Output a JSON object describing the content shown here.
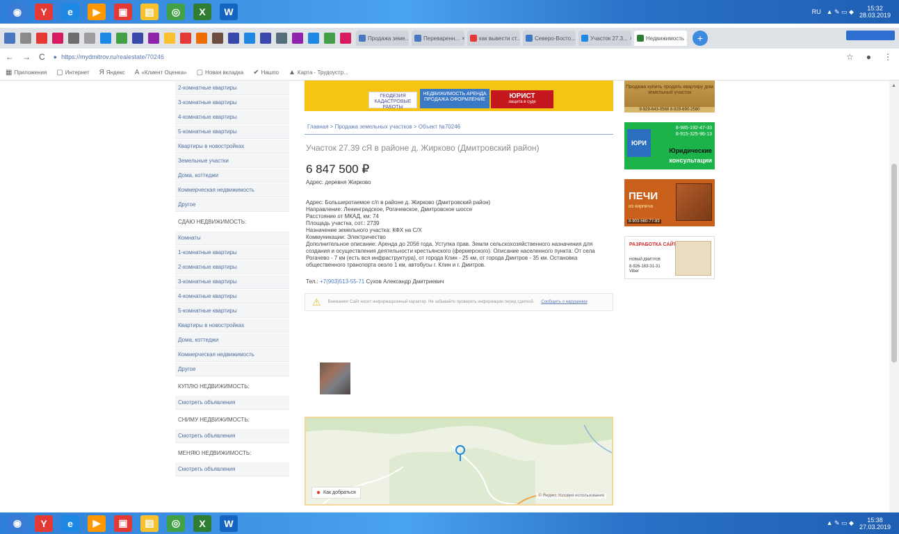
{
  "taskbar_top": {
    "icons": [
      {
        "name": "start-icon",
        "color": "#3a7bd5",
        "glyph": "◉"
      },
      {
        "name": "yandex-icon",
        "color": "#e53935",
        "glyph": "Y"
      },
      {
        "name": "ie-icon",
        "color": "#1e88e5",
        "glyph": "e"
      },
      {
        "name": "media-icon",
        "color": "#ff9800",
        "glyph": "▶"
      },
      {
        "name": "pdf-icon",
        "color": "#e53935",
        "glyph": "▣"
      },
      {
        "name": "explorer-icon",
        "color": "#fbc02d",
        "glyph": "▤"
      },
      {
        "name": "chrome-icon",
        "color": "#43a047",
        "glyph": "◎"
      },
      {
        "name": "excel-icon",
        "color": "#2e7d32",
        "glyph": "X"
      },
      {
        "name": "word-icon",
        "color": "#1565c0",
        "glyph": "W"
      }
    ],
    "tray_lang": "RU",
    "time": "15:32",
    "date": "28.03.2019"
  },
  "taskbar_bottom": {
    "time": "15:38",
    "date": "27.03.2019"
  },
  "tabs": [
    {
      "label": "Продажа земе...",
      "color": "#4a78c0"
    },
    {
      "label": "Переваренн...",
      "color": "#4a78c0"
    },
    {
      "label": "как вывести ст...",
      "color": "#e53935"
    },
    {
      "label": "Северо-Восто...",
      "color": "#3b79c7"
    },
    {
      "label": "Участок 27.3...",
      "color": "#1e88e5"
    },
    {
      "label": "Недвижимость",
      "color": "#2e7d32",
      "active": true
    }
  ],
  "toolbar": {
    "back": "←",
    "forward": "→",
    "reload": "C",
    "url_host": "https://mydmitrov.ru",
    "url_path": "/realestate/70246",
    "menu": "⋮"
  },
  "bookmarks": [
    {
      "icon": "apps-icon",
      "glyph": "▦",
      "label": "Приложения"
    },
    {
      "icon": "folder-icon",
      "glyph": "▢",
      "label": "Интернет"
    },
    {
      "icon": "yandex-bookmark-icon",
      "glyph": "Я",
      "label": "Яндекс"
    },
    {
      "icon": "a-icon",
      "glyph": "A",
      "label": "«Клиент Оценка»"
    },
    {
      "icon": "folder-icon",
      "glyph": "▢",
      "label": "Новая вкладка"
    },
    {
      "icon": "check-icon",
      "glyph": "✔",
      "label": "Нашпо"
    },
    {
      "icon": "maps-icon",
      "glyph": "▲",
      "label": "Карта - Трудоустр..."
    }
  ],
  "sidebar": {
    "group1": [
      "2-комнатные квартиры",
      "3-комнатные квартиры",
      "4-комнатные квартиры",
      "5-комнатные квартиры",
      "Квартиры в новостройках",
      "Земельные участки",
      "Дома, коттеджи",
      "Коммерческая недвижимость",
      "Другое"
    ],
    "rent_head": "Сдаю недвижимость:",
    "group2": [
      "Комнаты",
      "1-комнатные квартиры",
      "2-комнатные квартиры",
      "3-комнатные квартиры",
      "4-комнатные квартиры",
      "5-комнатные квартиры",
      "Квартиры в новостройках",
      "Дома, коттеджи",
      "Коммерческая недвижимость",
      "Другое"
    ],
    "buy_head": "Куплю недвижимость:",
    "buy_link": "Смотреть объявления",
    "hire_head": "Сниму недвижимость:",
    "hire_link": "Смотреть объявления",
    "swap_head": "Меняю недвижимость:",
    "swap_link": "Смотреть объявления"
  },
  "banner": {
    "b1": "ГЕОДЕЗИЯ КАДАСТРОВЫЕ РАБОТЫ",
    "b2": "НЕДВИЖИМОСТЬ АРЕНДА ПРОДАЖА ОФОРМЛЕНИЕ",
    "b3": "ЮРИСТ",
    "b3_sub": "защита в суде"
  },
  "listing": {
    "breadcrumbs": "Главная > Продажа земельных участков > Объект №70246",
    "title": "Участок 27.39 сЯ в районе д. Жирково (Дмитровский район)",
    "price": "6 847 500 ₽",
    "address": "Адрес: деревня Жирково",
    "details": [
      "Адрес: Большеротаемое с/п в районе д. Жирково (Дмитровский район)",
      "Направление: Ленинградское, Рогачевское, Дмитровское шоссе",
      "Расстояние от МКАД, км: 74",
      "Площадь участка, сот.: 2739",
      "Назначение земельного участка: КФХ на С/Х",
      "Коммуникации: Электричество"
    ],
    "description": "Дополнительное описание: Аренда до 2056 года. Уступка прав. Земли сельскохозяйственного назначения для создания и осуществления деятельности крестьянского (фермерского). Описание населенного пункта: От села Рогачево - 7 км (есть вся инфраструктура), от города Клин - 25 км, от города Дмитров - 35 км. Остановка общественного транспорта около 1 км, автобусы г. Клин и г. Дмитров.",
    "phone_label": "Тел.:",
    "phone": "+7(903)513-55-71",
    "contact": "Сухов Александр Дмитриевич",
    "warning": "Внимание! Сайт носит информационный характер. Не забывайте проверять информацию перед сделкой.",
    "warning_link": "Сообщить о нарушении",
    "map_route": "Как добраться",
    "map_copy": "© Яндекс Условия использования"
  },
  "ads": {
    "ad1_text": "Продажа купить продать квартиру дом земельный участок",
    "ad1_phone": "8-929-643-0568  8-929-690-2580",
    "ad2_logo": "ЮРИ",
    "ad2_phones": [
      "8-985-192-47-33",
      "8-915-325-96-13"
    ],
    "ad2_t1": "Юридические",
    "ad2_t2": "консультации",
    "ad3_title": "ПЕЧИ",
    "ad3_sub": "из кирпича",
    "ad3_phone": "8-903-560-77-83",
    "ad4_title": "РАЗРАБОТКА САЙТОВ",
    "ad4_sub": "НОВЫЙ ДМИТРОВ",
    "ad4_phone": "8-926-183-31-31",
    "ad4_phone_sub": "Viber"
  }
}
